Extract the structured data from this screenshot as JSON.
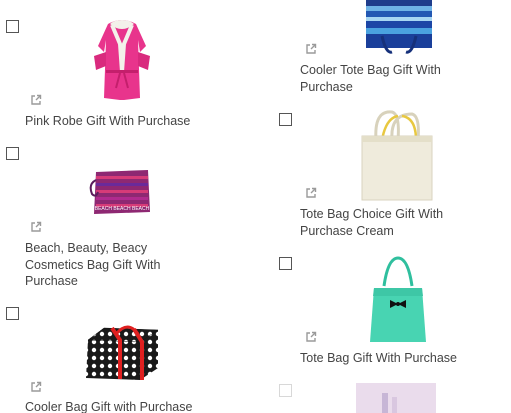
{
  "products": [
    {
      "key": "pink-robe",
      "label": "Pink Robe Gift With Purchase",
      "checked": false,
      "icon": "external-link-icon"
    },
    {
      "key": "cooler-tote",
      "label": "Cooler Tote Bag Gift With Purchase",
      "checked": false,
      "icon": "external-link-icon"
    },
    {
      "key": "beach-cosmetics",
      "label": "Beach, Beauty, Beacy Cosmetics Bag Gift With Purchase",
      "checked": false,
      "icon": "external-link-icon",
      "image_text": "BEACH BEACH BEACH"
    },
    {
      "key": "tote-cream",
      "label": "Tote Bag Choice Gift With Purchase Cream",
      "checked": false,
      "icon": "external-link-icon"
    },
    {
      "key": "cooler-bag",
      "label": "Cooler Bag Gift with Purchase",
      "checked": false,
      "icon": "external-link-icon"
    },
    {
      "key": "tote-teal",
      "label": "Tote Bag Gift With Purchase",
      "checked": false,
      "icon": "external-link-icon"
    },
    {
      "key": "partial-item",
      "label": "",
      "checked": false
    }
  ],
  "colors": {
    "text": "#444444",
    "checkbox_border": "#555555",
    "icon": "#9a9a9a"
  }
}
